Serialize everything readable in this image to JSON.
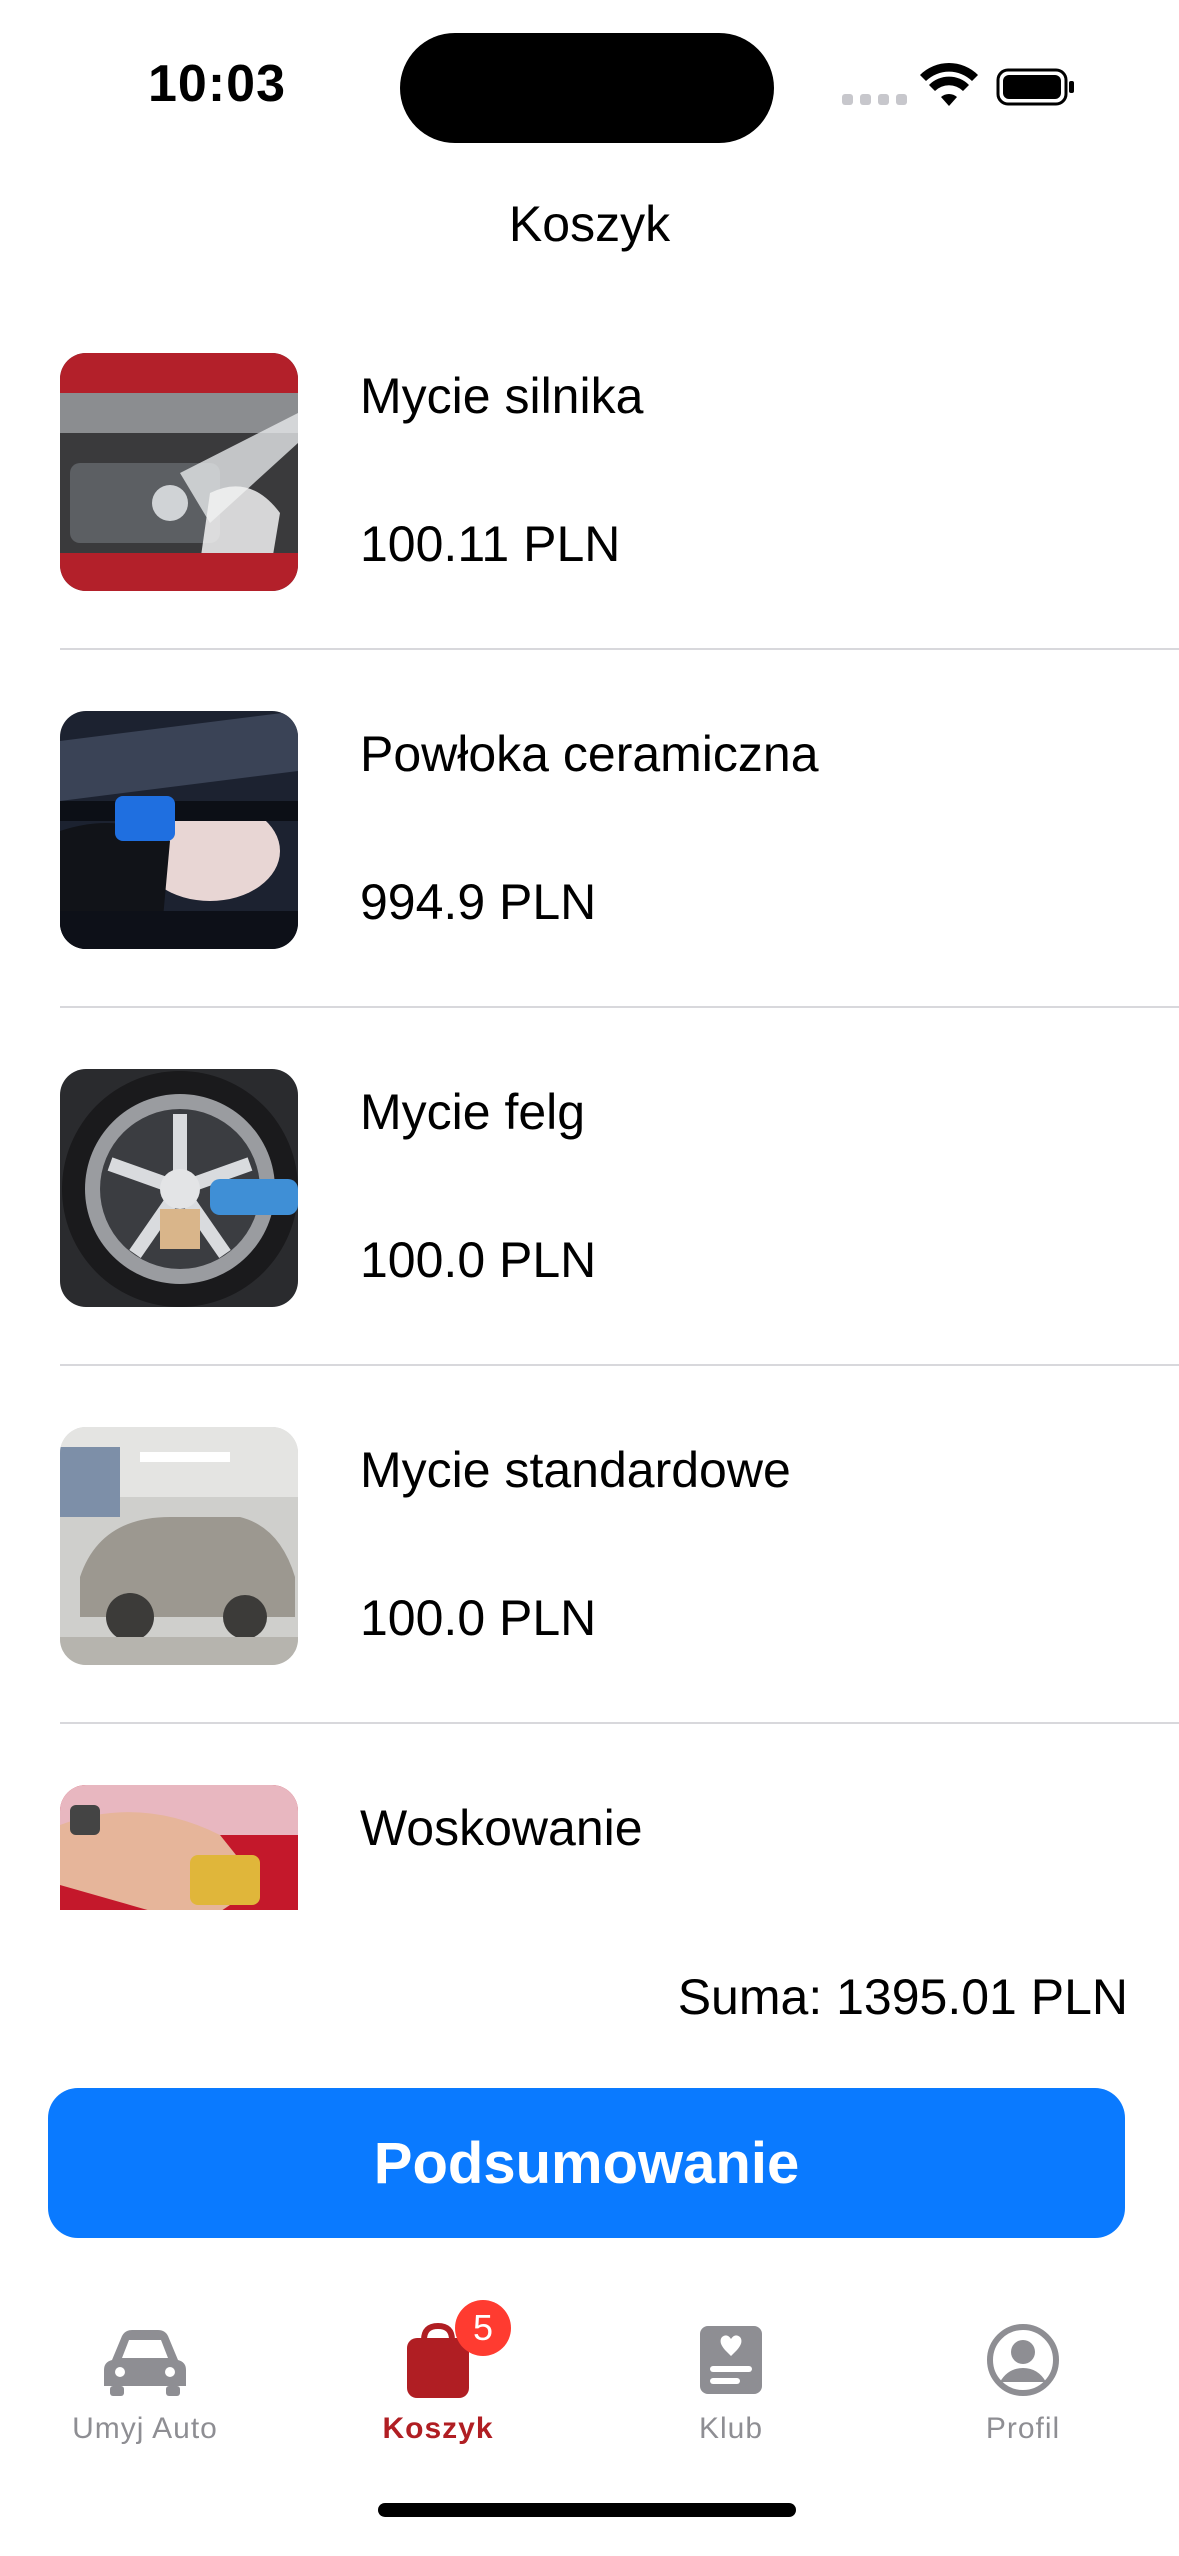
{
  "status_bar": {
    "time": "10:03"
  },
  "nav": {
    "title": "Koszyk"
  },
  "cart": {
    "items": [
      {
        "name": "Mycie silnika",
        "price": "100.11 PLN",
        "image_icon": "engine-wash-photo"
      },
      {
        "name": "Powłoka ceramiczna",
        "price": "994.9 PLN",
        "image_icon": "ceramic-coating-photo"
      },
      {
        "name": "Mycie felg",
        "price": "100.0 PLN",
        "image_icon": "rim-wash-photo"
      },
      {
        "name": "Mycie standardowe",
        "price": "100.0 PLN",
        "image_icon": "standard-wash-photo"
      },
      {
        "name": "Woskowanie",
        "price": "",
        "image_icon": "waxing-photo"
      }
    ],
    "sum": "Suma: 1395.01 PLN",
    "summary_button": "Podsumowanie"
  },
  "tab_bar": {
    "tabs": [
      {
        "label": "Umyj Auto",
        "icon": "car-icon",
        "active": false
      },
      {
        "label": "Koszyk",
        "icon": "shopping-bag-icon",
        "active": true,
        "badge": "5"
      },
      {
        "label": "Klub",
        "icon": "club-card-icon",
        "active": false
      },
      {
        "label": "Profil",
        "icon": "person-circle-icon",
        "active": false
      }
    ]
  },
  "colors": {
    "accent": "#0a7aff",
    "active_tab": "#b01e23",
    "badge": "#ff3b30",
    "inactive": "#8e8e93"
  }
}
